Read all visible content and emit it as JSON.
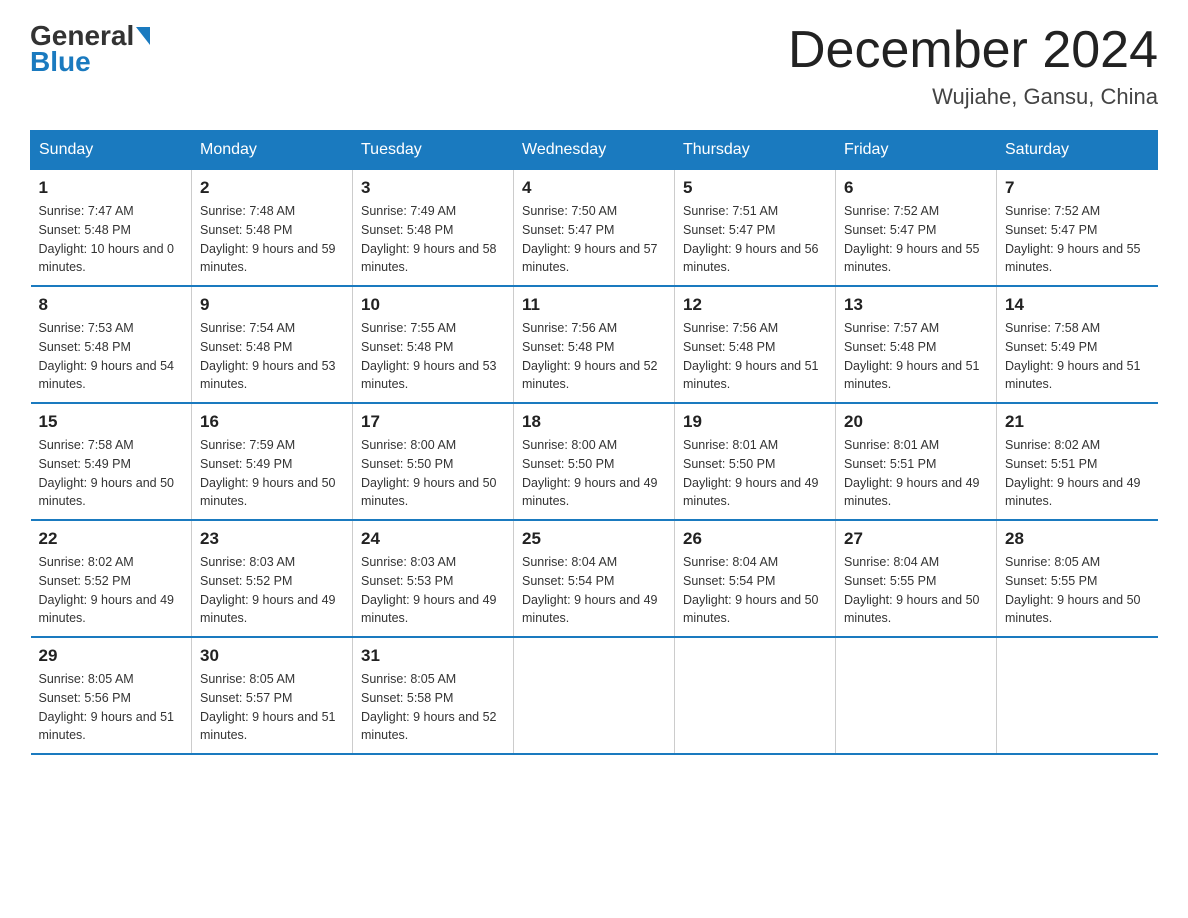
{
  "header": {
    "logo_general": "General",
    "logo_blue": "Blue",
    "title": "December 2024",
    "location": "Wujiahe, Gansu, China"
  },
  "days_of_week": [
    "Sunday",
    "Monday",
    "Tuesday",
    "Wednesday",
    "Thursday",
    "Friday",
    "Saturday"
  ],
  "weeks": [
    [
      {
        "day": "1",
        "sunrise": "7:47 AM",
        "sunset": "5:48 PM",
        "daylight": "10 hours and 0 minutes."
      },
      {
        "day": "2",
        "sunrise": "7:48 AM",
        "sunset": "5:48 PM",
        "daylight": "9 hours and 59 minutes."
      },
      {
        "day": "3",
        "sunrise": "7:49 AM",
        "sunset": "5:48 PM",
        "daylight": "9 hours and 58 minutes."
      },
      {
        "day": "4",
        "sunrise": "7:50 AM",
        "sunset": "5:47 PM",
        "daylight": "9 hours and 57 minutes."
      },
      {
        "day": "5",
        "sunrise": "7:51 AM",
        "sunset": "5:47 PM",
        "daylight": "9 hours and 56 minutes."
      },
      {
        "day": "6",
        "sunrise": "7:52 AM",
        "sunset": "5:47 PM",
        "daylight": "9 hours and 55 minutes."
      },
      {
        "day": "7",
        "sunrise": "7:52 AM",
        "sunset": "5:47 PM",
        "daylight": "9 hours and 55 minutes."
      }
    ],
    [
      {
        "day": "8",
        "sunrise": "7:53 AM",
        "sunset": "5:48 PM",
        "daylight": "9 hours and 54 minutes."
      },
      {
        "day": "9",
        "sunrise": "7:54 AM",
        "sunset": "5:48 PM",
        "daylight": "9 hours and 53 minutes."
      },
      {
        "day": "10",
        "sunrise": "7:55 AM",
        "sunset": "5:48 PM",
        "daylight": "9 hours and 53 minutes."
      },
      {
        "day": "11",
        "sunrise": "7:56 AM",
        "sunset": "5:48 PM",
        "daylight": "9 hours and 52 minutes."
      },
      {
        "day": "12",
        "sunrise": "7:56 AM",
        "sunset": "5:48 PM",
        "daylight": "9 hours and 51 minutes."
      },
      {
        "day": "13",
        "sunrise": "7:57 AM",
        "sunset": "5:48 PM",
        "daylight": "9 hours and 51 minutes."
      },
      {
        "day": "14",
        "sunrise": "7:58 AM",
        "sunset": "5:49 PM",
        "daylight": "9 hours and 51 minutes."
      }
    ],
    [
      {
        "day": "15",
        "sunrise": "7:58 AM",
        "sunset": "5:49 PM",
        "daylight": "9 hours and 50 minutes."
      },
      {
        "day": "16",
        "sunrise": "7:59 AM",
        "sunset": "5:49 PM",
        "daylight": "9 hours and 50 minutes."
      },
      {
        "day": "17",
        "sunrise": "8:00 AM",
        "sunset": "5:50 PM",
        "daylight": "9 hours and 50 minutes."
      },
      {
        "day": "18",
        "sunrise": "8:00 AM",
        "sunset": "5:50 PM",
        "daylight": "9 hours and 49 minutes."
      },
      {
        "day": "19",
        "sunrise": "8:01 AM",
        "sunset": "5:50 PM",
        "daylight": "9 hours and 49 minutes."
      },
      {
        "day": "20",
        "sunrise": "8:01 AM",
        "sunset": "5:51 PM",
        "daylight": "9 hours and 49 minutes."
      },
      {
        "day": "21",
        "sunrise": "8:02 AM",
        "sunset": "5:51 PM",
        "daylight": "9 hours and 49 minutes."
      }
    ],
    [
      {
        "day": "22",
        "sunrise": "8:02 AM",
        "sunset": "5:52 PM",
        "daylight": "9 hours and 49 minutes."
      },
      {
        "day": "23",
        "sunrise": "8:03 AM",
        "sunset": "5:52 PM",
        "daylight": "9 hours and 49 minutes."
      },
      {
        "day": "24",
        "sunrise": "8:03 AM",
        "sunset": "5:53 PM",
        "daylight": "9 hours and 49 minutes."
      },
      {
        "day": "25",
        "sunrise": "8:04 AM",
        "sunset": "5:54 PM",
        "daylight": "9 hours and 49 minutes."
      },
      {
        "day": "26",
        "sunrise": "8:04 AM",
        "sunset": "5:54 PM",
        "daylight": "9 hours and 50 minutes."
      },
      {
        "day": "27",
        "sunrise": "8:04 AM",
        "sunset": "5:55 PM",
        "daylight": "9 hours and 50 minutes."
      },
      {
        "day": "28",
        "sunrise": "8:05 AM",
        "sunset": "5:55 PM",
        "daylight": "9 hours and 50 minutes."
      }
    ],
    [
      {
        "day": "29",
        "sunrise": "8:05 AM",
        "sunset": "5:56 PM",
        "daylight": "9 hours and 51 minutes."
      },
      {
        "day": "30",
        "sunrise": "8:05 AM",
        "sunset": "5:57 PM",
        "daylight": "9 hours and 51 minutes."
      },
      {
        "day": "31",
        "sunrise": "8:05 AM",
        "sunset": "5:58 PM",
        "daylight": "9 hours and 52 minutes."
      },
      null,
      null,
      null,
      null
    ]
  ]
}
